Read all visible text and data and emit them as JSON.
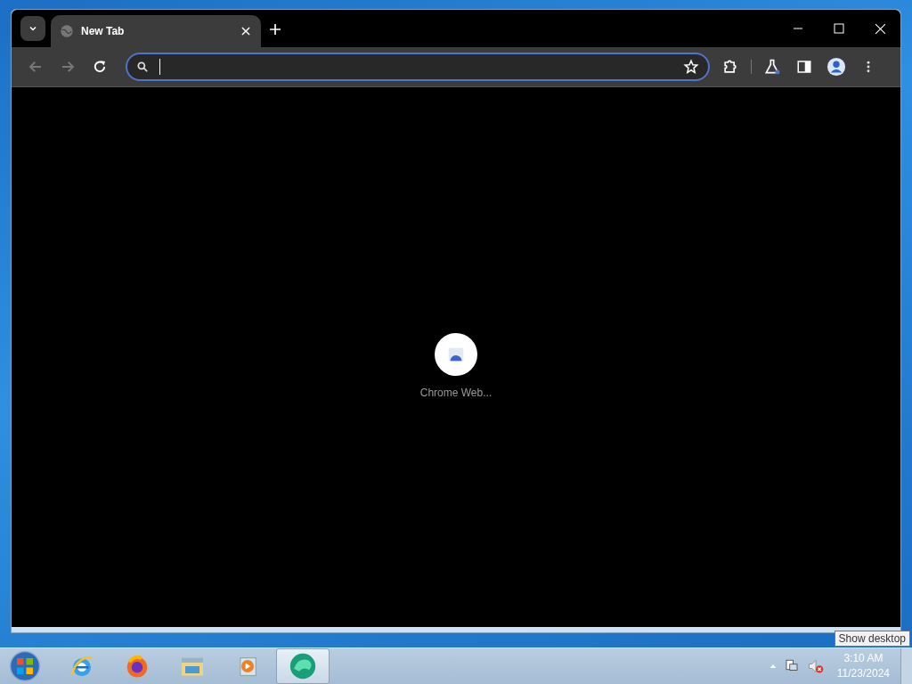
{
  "browser": {
    "tabs": [
      {
        "title": "New Tab",
        "selected": true
      }
    ],
    "new_tab_page": {
      "shortcuts": [
        {
          "title": "Chrome Web..."
        }
      ]
    }
  },
  "taskbar": {
    "apps": [
      {
        "kind": "ie",
        "selected": false
      },
      {
        "kind": "firefox",
        "selected": false
      },
      {
        "kind": "folder",
        "selected": false
      },
      {
        "kind": "media",
        "selected": false
      },
      {
        "kind": "edge",
        "selected": true
      }
    ],
    "clock": {
      "time": "3:10 AM",
      "date": "11/23/2024"
    },
    "tooltip": "Show desktop"
  }
}
